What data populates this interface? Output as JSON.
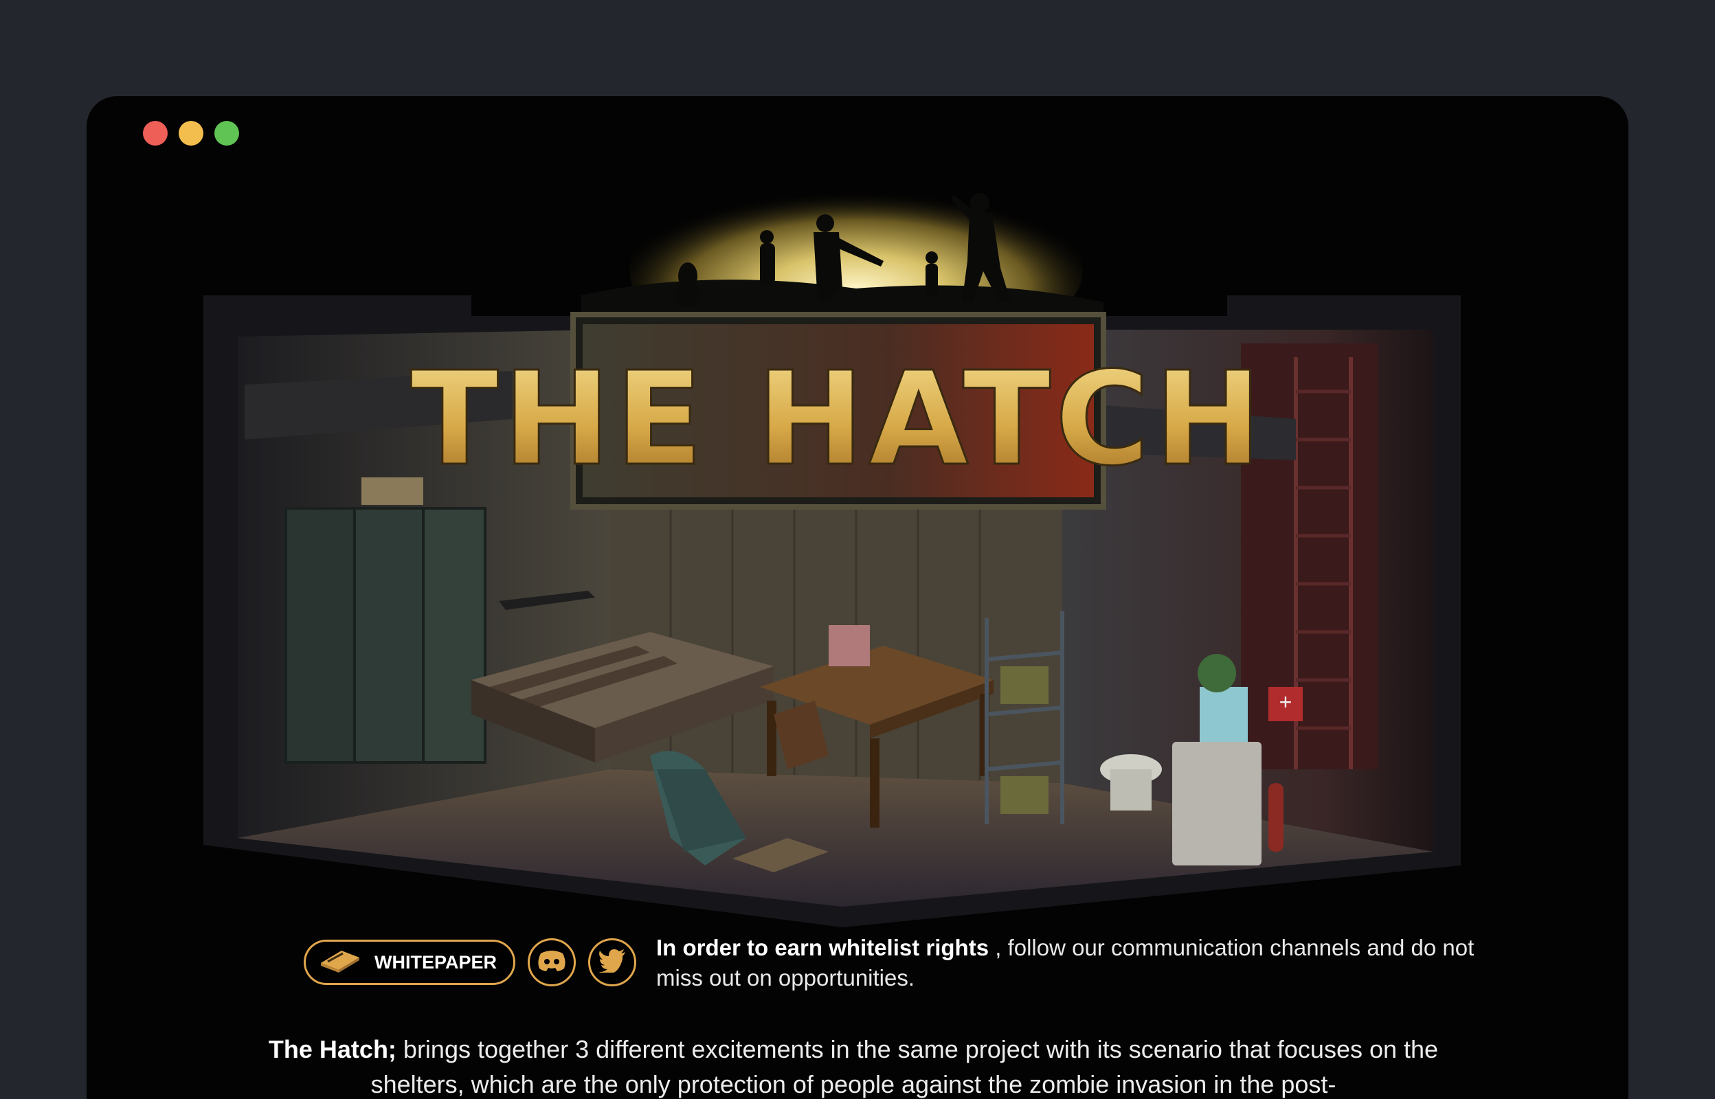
{
  "window": {
    "controls": [
      "close-dot",
      "minimize-dot",
      "maximize-dot"
    ]
  },
  "hero": {
    "logo_text": "THE HATCH"
  },
  "toolbar": {
    "whitepaper_label": "WHITEPAPER",
    "whitepaper_icon": "book-icon",
    "discord_icon": "discord-icon",
    "twitter_icon": "twitter-icon",
    "accent": "#e0a64c"
  },
  "whitelist": {
    "bold": "In order to earn whitelist rights",
    "rest": " , follow our communication channels and do not miss out on opportunities."
  },
  "description": {
    "bold": "The Hatch;",
    "rest": " brings together 3 different excitements in the same project with its scenario that focuses on the shelters, which are the only protection of people against the zombie invasion in the post-"
  },
  "colors": {
    "page_bg": "#23272d",
    "window_bg": "#030303",
    "close": "#ee5f57",
    "minimize": "#f4be4f",
    "maximize": "#5fc454"
  }
}
